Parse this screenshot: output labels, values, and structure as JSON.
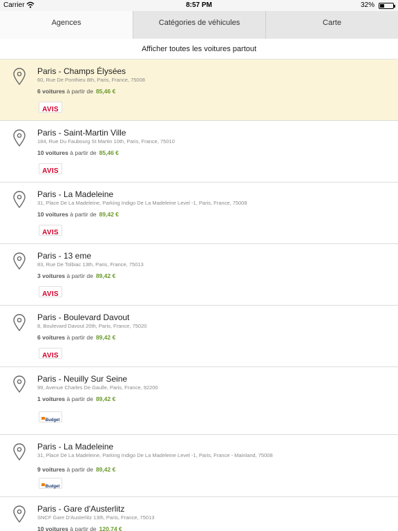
{
  "status_bar": {
    "carrier": "Carrier",
    "time": "8:57 PM",
    "battery": "32%",
    "battery_level": 0.32
  },
  "tabs": [
    {
      "label": "Agences",
      "active": true
    },
    {
      "label": "Catégories de véhicules",
      "active": false
    },
    {
      "label": "Carte",
      "active": false
    }
  ],
  "show_all_label": "Afficher toutes les voitures partout",
  "agencies": [
    {
      "name": "Paris - Champs Élysées",
      "address": "60, Rue De Ponthieu 8th, Paris, France, 75008",
      "count": "6 voitures",
      "from": "à partir de",
      "price": "85,46 €",
      "brand": "AVIS",
      "selected": true
    },
    {
      "name": "Paris - Saint-Martin Ville",
      "address": "184, Rue Du Faubourg St Martin 10th, Paris, France, 75010",
      "count": "10 voitures",
      "from": "à partir de",
      "price": "85,46 €",
      "brand": "AVIS"
    },
    {
      "name": "Paris - La Madeleine",
      "address": "31, Place De La Madeleine, Parking Indigo De La Madeleine Level -1, Paris, France, 75008",
      "count": "10 voitures",
      "from": "à partir de",
      "price": "89,42 €",
      "brand": "AVIS"
    },
    {
      "name": "Paris - 13 eme",
      "address": "83, Rue De Tolbiac 13th, Paris, France, 75013",
      "count": "3 voitures",
      "from": "à partir de",
      "price": "89,42 €",
      "brand": "AVIS"
    },
    {
      "name": "Paris - Boulevard Davout",
      "address": "8, Boulevard Davout 20th, Paris, France, 75020",
      "count": "6 voitures",
      "from": "à partir de",
      "price": "89,42 €",
      "brand": "AVIS"
    },
    {
      "name": "Paris - Neuilly Sur Seine",
      "address": "99, Avenue Charles De Gaulle, Paris, France, 92200",
      "count": "1 voitures",
      "from": "à partir de",
      "price": "89,42 €",
      "brand": "Budget"
    },
    {
      "name": "Paris - La Madeleine",
      "address": "31, Place De La Madeleine, Parking Indigo De La Madeleine Level -1, Paris, France - Mainland, 75008",
      "count": "9 voitures",
      "from": "à partir de",
      "price": "89,42 €",
      "brand": "Budget"
    },
    {
      "name": "Paris - Gare d'Austerlitz",
      "address": "SNCF Gare D'Austerlitz 13th, Paris, France, 75013",
      "count": "10 voitures",
      "from": "à partir de",
      "price": "120,74 €",
      "brand": ""
    }
  ],
  "icons": {
    "pin": "map-pin-icon",
    "wifi": "wifi-icon",
    "battery": "battery-icon"
  },
  "colors": {
    "price": "#6a9a2a",
    "selected_row": "#fbf4d8",
    "avis": "#d4002a"
  }
}
